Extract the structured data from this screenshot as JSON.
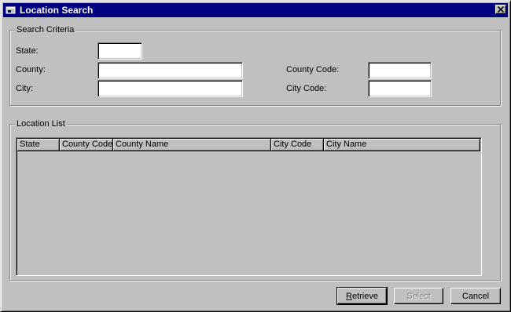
{
  "window": {
    "title": "Location Search"
  },
  "search_criteria": {
    "group_label": "Search Criteria",
    "state_label": "State:",
    "state_value": "",
    "county_label": "County:",
    "county_value": "",
    "city_label": "City:",
    "city_value": "",
    "county_code_label": "County Code:",
    "county_code_value": "",
    "city_code_label": "City Code:",
    "city_code_value": ""
  },
  "location_list": {
    "group_label": "Location List",
    "columns": [
      "State",
      "County Code",
      "County Name",
      "City Code",
      "City Name"
    ],
    "rows": []
  },
  "buttons": {
    "retrieve_prefix": "R",
    "retrieve_rest": "etrieve",
    "select_label": "Select",
    "cancel_label": "Cancel"
  },
  "icons": {
    "title": "app-window-icon",
    "close": "close-icon"
  }
}
